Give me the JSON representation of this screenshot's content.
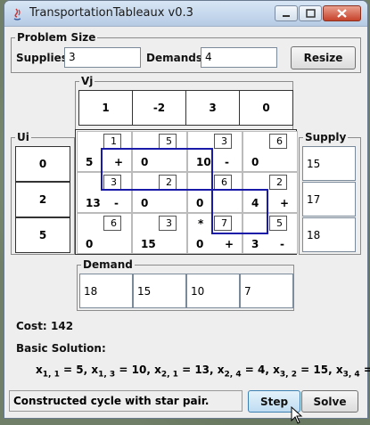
{
  "window": {
    "title": "TransportationTableaux v0.3"
  },
  "problem_size": {
    "title": "Problem Size",
    "supplies_label": "Supplies:",
    "supplies_value": "3",
    "demands_label": "Demands:",
    "demands_value": "4",
    "resize_label": "Resize"
  },
  "vj": {
    "title": "Vj",
    "values": [
      "1",
      "-2",
      "3",
      "0"
    ]
  },
  "ui": {
    "title": "Ui",
    "values": [
      "0",
      "2",
      "5"
    ]
  },
  "supply": {
    "title": "Supply",
    "values": [
      "15",
      "17",
      "18"
    ]
  },
  "demand": {
    "title": "Demand",
    "values": [
      "18",
      "15",
      "10",
      "7"
    ]
  },
  "tableau": {
    "rows": [
      [
        {
          "cost": "1",
          "flow": "5",
          "sign": "+"
        },
        {
          "cost": "5",
          "flow": "0",
          "sign": ""
        },
        {
          "cost": "3",
          "flow": "10",
          "sign": "-"
        },
        {
          "cost": "6",
          "flow": "0",
          "sign": ""
        }
      ],
      [
        {
          "cost": "3",
          "flow": "13",
          "sign": "-"
        },
        {
          "cost": "2",
          "flow": "0",
          "sign": ""
        },
        {
          "cost": "6",
          "flow": "0",
          "sign": ""
        },
        {
          "cost": "2",
          "flow": "4",
          "sign": "+"
        }
      ],
      [
        {
          "cost": "6",
          "flow": "0",
          "sign": ""
        },
        {
          "cost": "3",
          "flow": "15",
          "sign": ""
        },
        {
          "cost": "7",
          "flow": "0",
          "sign": "+",
          "star": "*"
        },
        {
          "cost": "5",
          "flow": "3",
          "sign": "-"
        }
      ]
    ]
  },
  "cost": {
    "label": "Cost:",
    "value": "142"
  },
  "basic_solution": {
    "label": "Basic Solution:",
    "terms": [
      {
        "var": "x",
        "sub": "1, 1",
        "value": "5"
      },
      {
        "var": "x",
        "sub": "1, 3",
        "value": "10"
      },
      {
        "var": "x",
        "sub": "2, 1",
        "value": "13"
      },
      {
        "var": "x",
        "sub": "2, 4",
        "value": "4"
      },
      {
        "var": "x",
        "sub": "3, 2",
        "value": "15"
      },
      {
        "var": "x",
        "sub": "3, 4",
        "value": "3"
      }
    ]
  },
  "status": "Constructed cycle with star pair.",
  "buttons": {
    "step": "Step",
    "solve": "Solve"
  },
  "colors": {
    "cycle": "#1a1aa8",
    "title_bar": "#c3d6ec",
    "close": "#c7422b"
  },
  "icons": [
    "java-app-icon",
    "minimize-icon",
    "maximize-icon",
    "close-icon",
    "cursor-icon"
  ]
}
